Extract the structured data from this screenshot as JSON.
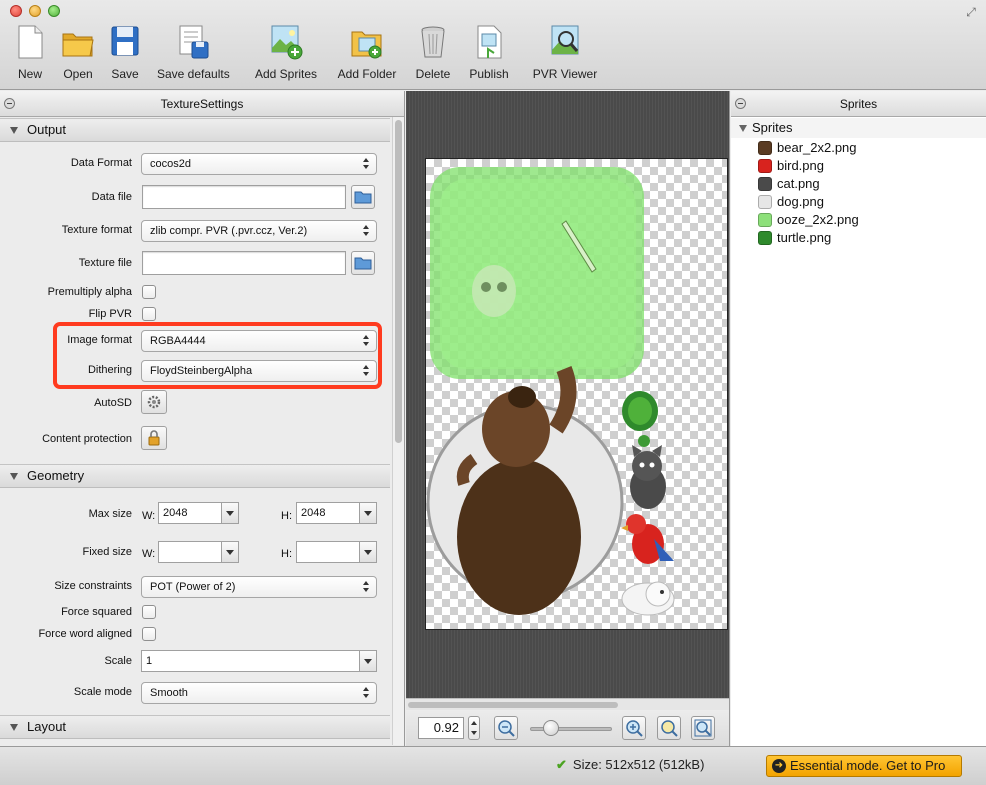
{
  "toolbar": {
    "new_label": "New",
    "open_label": "Open",
    "save_label": "Save",
    "save_defaults_label": "Save defaults",
    "add_sprites_label": "Add Sprites",
    "add_folder_label": "Add Folder",
    "delete_label": "Delete",
    "publish_label": "Publish",
    "pvr_viewer_label": "PVR Viewer"
  },
  "texture_settings": {
    "title": "TextureSettings",
    "output": {
      "section_label": "Output",
      "data_format_label": "Data Format",
      "data_format_value": "cocos2d",
      "data_file_label": "Data file",
      "data_file_value": "",
      "texture_format_label": "Texture format",
      "texture_format_value": "zlib compr. PVR (.pvr.ccz, Ver.2)",
      "texture_file_label": "Texture file",
      "texture_file_value": "",
      "premultiply_alpha_label": "Premultiply alpha",
      "flip_pvr_label": "Flip PVR",
      "image_format_label": "Image format",
      "image_format_value": "RGBA4444",
      "dithering_label": "Dithering",
      "dithering_value": "FloydSteinbergAlpha",
      "autosd_label": "AutoSD",
      "content_protection_label": "Content protection"
    },
    "geometry": {
      "section_label": "Geometry",
      "max_size_label": "Max size",
      "w_label": "W:",
      "h_label": "H:",
      "max_w_value": "2048",
      "max_h_value": "2048",
      "fixed_size_label": "Fixed size",
      "fixed_w_value": "",
      "fixed_h_value": "",
      "size_constraints_label": "Size constraints",
      "size_constraints_value": "POT (Power of 2)",
      "force_squared_label": "Force squared",
      "force_word_aligned_label": "Force word aligned",
      "scale_label": "Scale",
      "scale_value": "1",
      "scale_mode_label": "Scale mode",
      "scale_mode_value": "Smooth"
    },
    "layout": {
      "section_label": "Layout"
    }
  },
  "preview": {
    "zoom_value": "0.92",
    "zoom_level": 0.18
  },
  "sprites": {
    "title": "Sprites",
    "group_label": "Sprites",
    "items": [
      {
        "name": "bear_2x2.png",
        "icon": "bear-icon",
        "color": "#5a3b22"
      },
      {
        "name": "bird.png",
        "icon": "bird-icon",
        "color": "#d8231e"
      },
      {
        "name": "cat.png",
        "icon": "cat-icon",
        "color": "#4a4a4a"
      },
      {
        "name": "dog.png",
        "icon": "dog-icon",
        "color": "#e6e6e6"
      },
      {
        "name": "ooze_2x2.png",
        "icon": "ooze-icon",
        "color": "#8de07a"
      },
      {
        "name": "turtle.png",
        "icon": "turtle-icon",
        "color": "#2f8a2c"
      }
    ]
  },
  "status": {
    "size_text": "Size: 512x512 (512kB)",
    "pro_label": "Essential mode. Get to Pro"
  },
  "colors": {
    "highlight": "#ff3b1f",
    "accent": "#f3a300",
    "success": "#4ba321"
  }
}
